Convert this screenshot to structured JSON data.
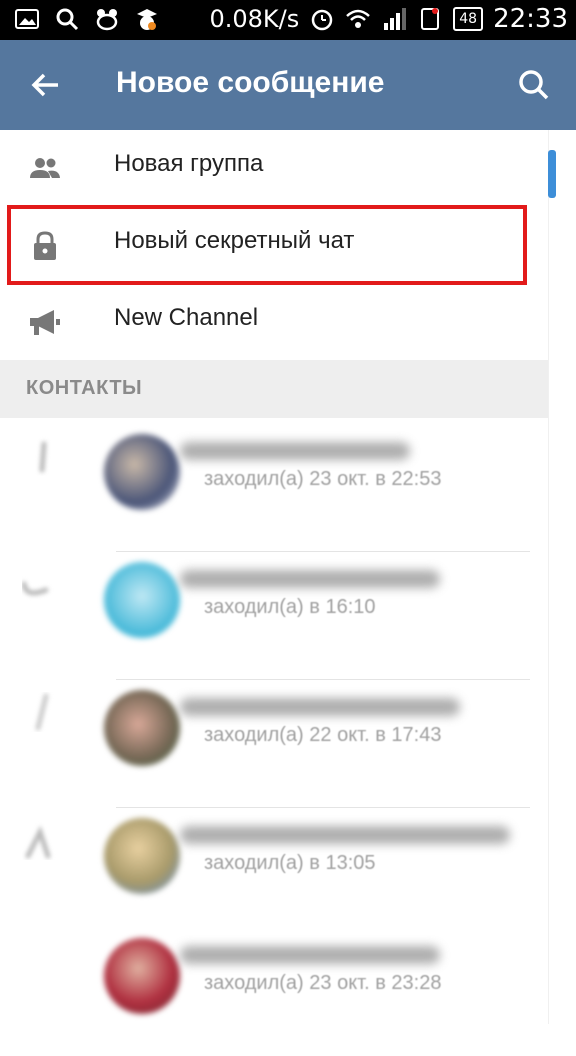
{
  "status_bar": {
    "network_speed": "0.08K/s",
    "battery": "48",
    "time": "22:33",
    "icons": [
      "image-icon",
      "search-icon",
      "app-icon",
      "owl-icon",
      "alarm-icon",
      "wifi-icon",
      "signal-icon",
      "no-sim-icon"
    ]
  },
  "app_bar": {
    "title": "Новое сообщение",
    "background": "#55779e"
  },
  "menu": [
    {
      "label": "Новая группа",
      "icon": "group-icon"
    },
    {
      "label": "Новый секретный чат",
      "icon": "lock-icon",
      "highlighted": true
    },
    {
      "label": "New Channel",
      "icon": "megaphone-icon"
    }
  ],
  "section_header": "КОНТАКТЫ",
  "contacts": [
    {
      "status": "заходил(а) 23 окт. в 22:53",
      "avatar_color": "#6a6f86"
    },
    {
      "status": "заходил(а) в 16:10",
      "avatar_color": "#44b8d8"
    },
    {
      "status": "заходил(а) 22 окт. в 17:43",
      "avatar_color": "#7a6a58"
    },
    {
      "status": "заходил(а) в 13:05",
      "avatar_color": "#a89a6a"
    },
    {
      "status": "заходил(а) 23 окт. в 23:28",
      "avatar_color": "#b03040"
    }
  ],
  "colors": {
    "accent": "#3d8ed8",
    "highlight": "#e21a1a"
  }
}
